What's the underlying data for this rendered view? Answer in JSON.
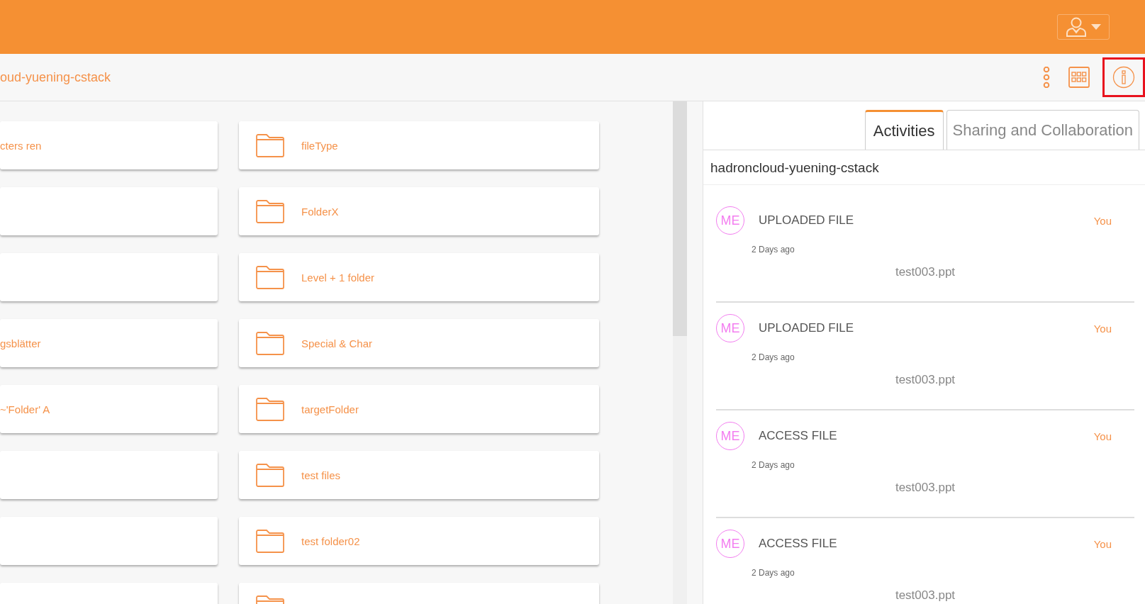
{
  "breadcrumb": "oud-yuening-cstack",
  "folders": [
    {
      "name": "cters ren",
      "kind": "clipped"
    },
    {
      "name": "fileType",
      "kind": "full"
    },
    {
      "kind": "clipped"
    },
    {
      "name": "FolderX",
      "kind": "full"
    },
    {
      "kind": "clipped"
    },
    {
      "name": "Level + 1 folder",
      "kind": "full"
    },
    {
      "name": "gsblätter",
      "kind": "clipped"
    },
    {
      "name": "Special & Char",
      "kind": "full"
    },
    {
      "name": "~'Folder' A",
      "kind": "clipped"
    },
    {
      "name": "targetFolder",
      "kind": "full"
    },
    {
      "kind": "clipped"
    },
    {
      "name": "test files",
      "kind": "full"
    },
    {
      "kind": "clipped"
    },
    {
      "name": "test folder02",
      "kind": "full"
    },
    {
      "kind": "clipped"
    },
    {
      "kind": "full"
    }
  ],
  "tabs": [
    {
      "label": "Activities",
      "selected": true
    },
    {
      "label": "Sharing and Collaboration",
      "selected": false
    }
  ],
  "panel_title": "hadroncloud-yuening-cstack",
  "activities": [
    {
      "avatar": "ME",
      "action": "UPLOADED FILE",
      "actor": "You",
      "time": "2 Days ago",
      "file": "test003.ppt"
    },
    {
      "avatar": "ME",
      "action": "UPLOADED FILE",
      "actor": "You",
      "time": "2 Days ago",
      "file": "test003.ppt"
    },
    {
      "avatar": "ME",
      "action": "ACCESS FILE",
      "actor": "You",
      "time": "2 Days ago",
      "file": "test003.ppt"
    },
    {
      "avatar": "ME",
      "action": "ACCESS FILE",
      "actor": "You",
      "time": "2 Days ago",
      "file": "test003.ppt"
    }
  ]
}
